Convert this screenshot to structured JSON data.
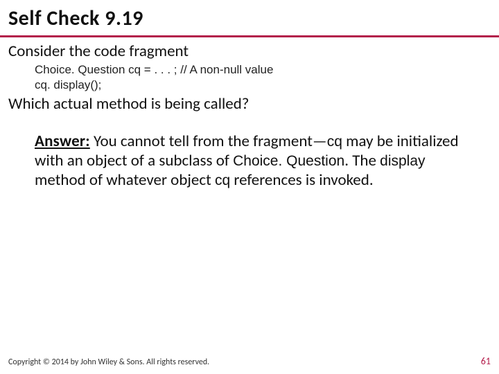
{
  "header": {
    "title": "Self Check 9.19"
  },
  "body": {
    "intro": "Consider the code fragment",
    "code_line1": "Choice. Question cq = . . . ; // A non-null value",
    "code_line2": "cq. display();",
    "question": "Which actual method is being called?",
    "answer_label": "Answer:",
    "answer_text_a": " You cannot tell from the fragment—",
    "answer_text_cq": "cq",
    "answer_text_b": " may be initialized with an object of a subclass of ",
    "answer_cls": "Choice. Question",
    "answer_text_c": ". The ",
    "answer_method": "display",
    "answer_text_d": " method of whatever object ",
    "answer_cq2": "cq",
    "answer_text_e": " references is invoked."
  },
  "footer": {
    "copyright": "Copyright © 2014 by John Wiley & Sons. All rights reserved.",
    "page": "61"
  }
}
